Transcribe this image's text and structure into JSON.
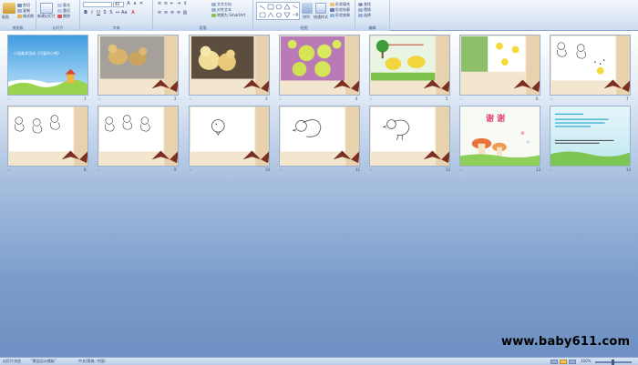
{
  "ribbon": {
    "groups": {
      "clipboard": "剪贴板",
      "slides": "幻灯片",
      "font": "字体",
      "paragraph": "段落",
      "drawing": "绘图",
      "editing": "编辑"
    },
    "paste_label": "粘贴",
    "cut_label": "剪切",
    "copy_label": "复制",
    "format_painter_label": "格式刷",
    "new_slide_label": "新建幻灯片",
    "layout_label": "版式",
    "reset_label": "重设",
    "delete_label": "删除",
    "font_size_value": "40",
    "text_direction_label": "文字方向",
    "align_text_label": "对齐文本",
    "smartart_label": "转换为 SmartArt",
    "arrange_label": "排列",
    "quick_styles_label": "快速样式",
    "shape_fill_label": "形状填充",
    "shape_outline_label": "形状轮廓",
    "shape_effects_label": "形状效果",
    "find_label": "查找",
    "replace_label": "替换",
    "select_label": "选择"
  },
  "slides": [
    {
      "num": "1",
      "title": "小班美术活动《可爱的小鸡》"
    },
    {
      "num": "2"
    },
    {
      "num": "3"
    },
    {
      "num": "4"
    },
    {
      "num": "5"
    },
    {
      "num": "6"
    },
    {
      "num": "7"
    },
    {
      "num": "8"
    },
    {
      "num": "9"
    },
    {
      "num": "10"
    },
    {
      "num": "11"
    },
    {
      "num": "12"
    },
    {
      "num": "13",
      "title": "谢 谢"
    },
    {
      "num": "14"
    }
  ],
  "slide_icon": "☆",
  "watermark": "www.baby611.com",
  "status": {
    "view": "幻灯片浏览",
    "theme": "\"默認设计模板\"",
    "lang": "中文(简体, 中国)",
    "zoom": "100%"
  },
  "colors": {
    "ribbon_bg": "#dde8f6",
    "workspace_top": "#ffffff",
    "workspace_bottom": "#6e90c2",
    "ribbon_brown": "#7b2e22"
  }
}
